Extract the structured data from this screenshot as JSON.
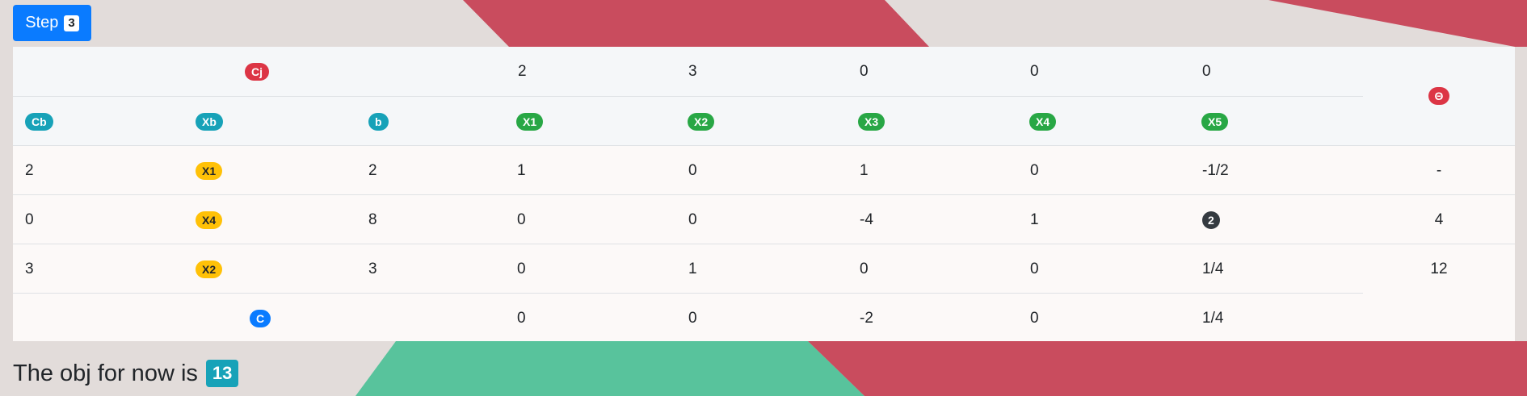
{
  "colors": {
    "primary": "#0a7bff",
    "danger": "#dc3545",
    "info": "#17a2b8",
    "success": "#28a745",
    "warning": "#ffc107",
    "dark": "#343a40"
  },
  "step": {
    "label": "Step",
    "number": "3"
  },
  "tableau": {
    "cj_label": "Cj",
    "cj_values": [
      "2",
      "3",
      "0",
      "0",
      "0"
    ],
    "theta_label": "Θ",
    "headers": {
      "cb": "Cb",
      "xb": "Xb",
      "b": "b",
      "vars": [
        "X1",
        "X2",
        "X3",
        "X4",
        "X5"
      ]
    },
    "rows": [
      {
        "cb": "2",
        "xb": "X1",
        "b": "2",
        "coeffs": [
          "1",
          "0",
          "1",
          "0",
          "-1/2"
        ],
        "theta": "-"
      },
      {
        "cb": "0",
        "xb": "X4",
        "b": "8",
        "coeffs": [
          "0",
          "0",
          "-4",
          "1",
          "2"
        ],
        "theta": "4"
      },
      {
        "cb": "3",
        "xb": "X2",
        "b": "3",
        "coeffs": [
          "0",
          "1",
          "0",
          "0",
          "1/4"
        ],
        "theta": "12"
      }
    ],
    "c_label": "C",
    "c_values": [
      "0",
      "0",
      "-2",
      "0",
      "1/4"
    ]
  },
  "objective": {
    "text": "The obj for now is",
    "value": "13"
  }
}
